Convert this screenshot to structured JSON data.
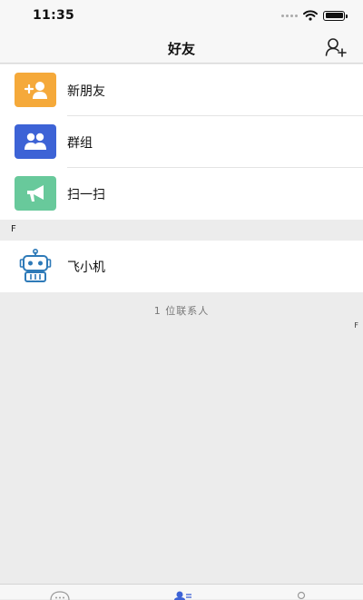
{
  "status_bar": {
    "time": "11:35"
  },
  "nav": {
    "title": "好友"
  },
  "menu": [
    {
      "label": "新朋友",
      "icon": "add-user-icon",
      "color": "#f5a93a"
    },
    {
      "label": "群组",
      "icon": "group-icon",
      "color": "#3d63d6"
    },
    {
      "label": "扫一扫",
      "icon": "megaphone-icon",
      "color": "#68c99b"
    }
  ],
  "section": {
    "letter": "F"
  },
  "contacts": [
    {
      "name": "飞小机",
      "icon": "robot-icon"
    }
  ],
  "contact_count": "1 位联系人",
  "index_bar": [
    "F"
  ],
  "colors": {
    "accent": "#3d63d6",
    "background": "#ececec",
    "nav_background": "#f7f7f7"
  }
}
